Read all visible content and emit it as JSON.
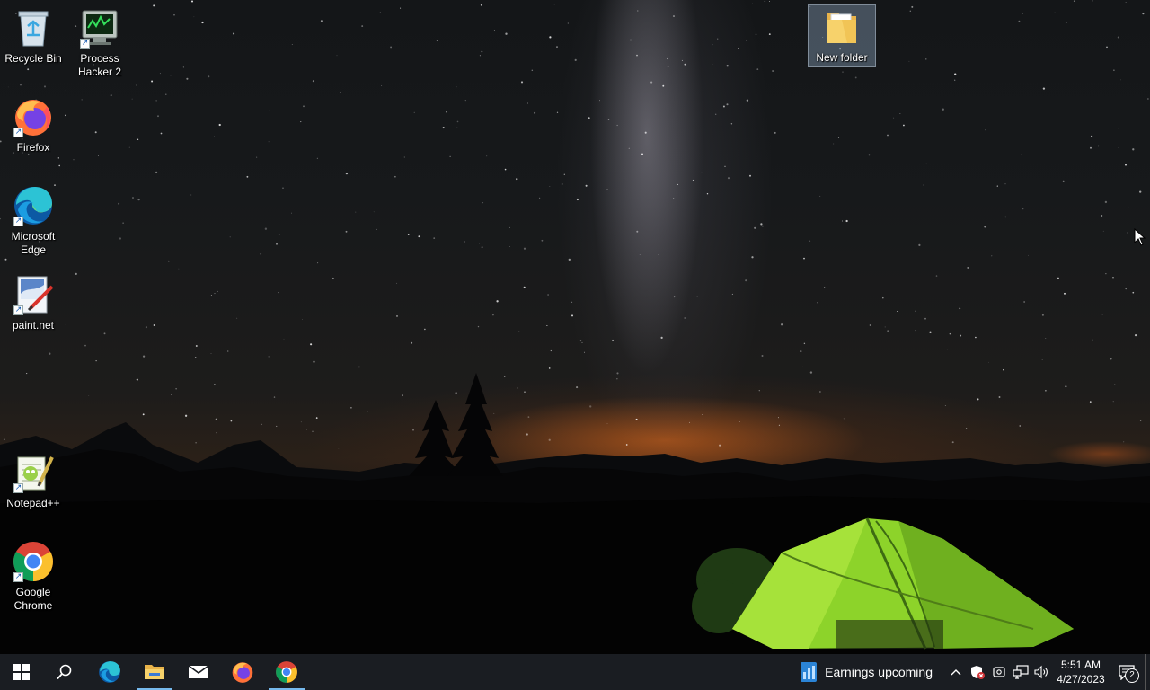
{
  "desktop": {
    "icons": [
      {
        "label": "Recycle Bin",
        "icon": "recycle-bin-icon",
        "shortcut": false
      },
      {
        "label": "Process\nHacker 2",
        "icon": "process-hacker-icon",
        "shortcut": true
      },
      {
        "label": "Firefox",
        "icon": "firefox-icon",
        "shortcut": true
      },
      {
        "label": "Microsoft\nEdge",
        "icon": "edge-icon",
        "shortcut": true
      },
      {
        "label": "paint.net",
        "icon": "paintnet-icon",
        "shortcut": true
      },
      {
        "label": "Notepad++",
        "icon": "notepadpp-icon",
        "shortcut": true
      },
      {
        "label": "Google\nChrome",
        "icon": "chrome-icon",
        "shortcut": true
      },
      {
        "label": "New folder",
        "icon": "folder-icon",
        "shortcut": false,
        "selected": true
      }
    ]
  },
  "taskbar": {
    "buttons": [
      {
        "name": "start",
        "icon": "windows-logo-icon"
      },
      {
        "name": "search",
        "icon": "search-icon"
      },
      {
        "name": "edge",
        "icon": "edge-icon"
      },
      {
        "name": "file-explorer",
        "icon": "folder-icon",
        "running": true
      },
      {
        "name": "mail",
        "icon": "mail-icon"
      },
      {
        "name": "firefox",
        "icon": "firefox-icon"
      },
      {
        "name": "chrome",
        "icon": "chrome-icon",
        "running": true
      }
    ],
    "news_widget": {
      "text": "Earnings upcoming",
      "icon": "stock-chart-icon"
    },
    "tray_icons": [
      "chevron-up-icon",
      "security-alert-icon",
      "meet-now-icon",
      "network-icon",
      "volume-icon"
    ],
    "clock": {
      "time": "5:51 AM",
      "date": "4/27/2023"
    },
    "notifications": {
      "count": "2",
      "icon": "action-center-icon"
    }
  },
  "colors": {
    "taskbar_bg": "#1a1d22",
    "running_indicator": "#76b9ed"
  }
}
